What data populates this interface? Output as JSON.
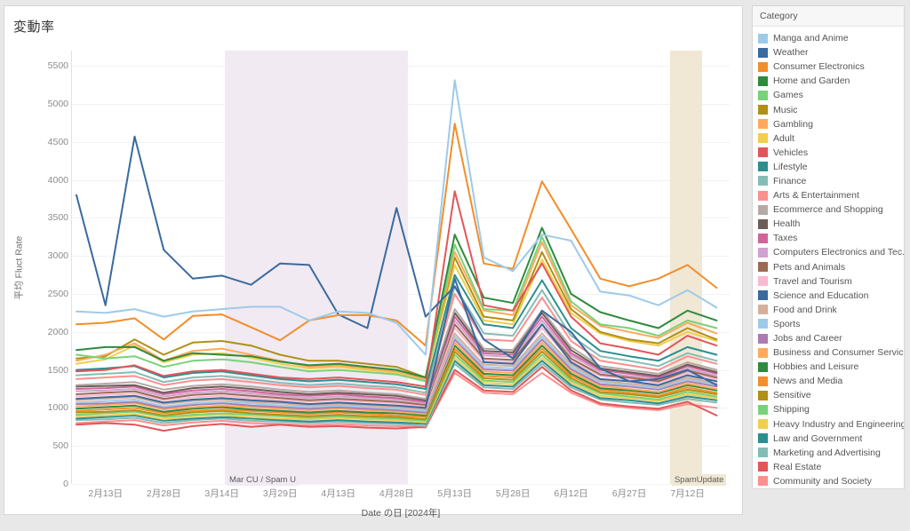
{
  "chart_title": "変動率",
  "axes": {
    "y_title": "平均 Fluct Rate",
    "y_ticks": [
      0,
      500,
      1000,
      1500,
      2000,
      2500,
      3000,
      3500,
      4000,
      4500,
      5000,
      5500
    ],
    "x_title": "Date の日 [2024年]",
    "x_ticks": [
      "2月13日",
      "2月28日",
      "3月14日",
      "3月29日",
      "4月13日",
      "4月28日",
      "5月13日",
      "5月28日",
      "6月12日",
      "6月27日",
      "7月12日"
    ]
  },
  "legend": {
    "header": "Category",
    "items": [
      {
        "label": "Manga and Anime",
        "color": "#9ecae9"
      },
      {
        "label": "Weather",
        "color": "#3a6a9e"
      },
      {
        "label": "Consumer Electronics",
        "color": "#f28e2b"
      },
      {
        "label": "Home and Garden",
        "color": "#2f8a3e"
      },
      {
        "label": "Games",
        "color": "#79d279"
      },
      {
        "label": "Music",
        "color": "#b09015"
      },
      {
        "label": "Gambling",
        "color": "#ffa95e"
      },
      {
        "label": "Adult",
        "color": "#f0ce4e"
      },
      {
        "label": "Vehicles",
        "color": "#e15759"
      },
      {
        "label": "Lifestyle",
        "color": "#2d8e8e"
      },
      {
        "label": "Finance",
        "color": "#86bcb6"
      },
      {
        "label": "Arts & Entertainment",
        "color": "#fd8f8f"
      },
      {
        "label": "Ecommerce and Shopping",
        "color": "#b5a9a5"
      },
      {
        "label": "Health",
        "color": "#6b5e57"
      },
      {
        "label": "Taxes",
        "color": "#d0659a"
      },
      {
        "label": "Computers Electronics and Tec..",
        "color": "#cfa2cf"
      },
      {
        "label": "Pets and Animals",
        "color": "#9c6b54"
      },
      {
        "label": "Travel and Tourism",
        "color": "#f9b9cf"
      },
      {
        "label": "Science and Education",
        "color": "#3a6a9e"
      },
      {
        "label": "Food and Drink",
        "color": "#d3b09c"
      },
      {
        "label": "Sports",
        "color": "#9ecae9"
      },
      {
        "label": "Jobs and Career",
        "color": "#ac7cb0"
      },
      {
        "label": "Business and Consumer Services",
        "color": "#ffa95e"
      },
      {
        "label": "Hobbies and Leisure",
        "color": "#2f8a3e"
      },
      {
        "label": "News and Media",
        "color": "#f28e2b"
      },
      {
        "label": "Sensitive",
        "color": "#b09015"
      },
      {
        "label": "Shipping",
        "color": "#79d279"
      },
      {
        "label": "Heavy Industry and Engineering",
        "color": "#f0ce4e"
      },
      {
        "label": "Law and Government",
        "color": "#2d8e8e"
      },
      {
        "label": "Marketing and Advertising",
        "color": "#86bcb6"
      },
      {
        "label": "Real Estate",
        "color": "#e15759"
      },
      {
        "label": "Community and Society",
        "color": "#fd8f8f"
      }
    ]
  },
  "annotations": [
    {
      "label": "Mar CU / Spam U",
      "color": "#f1eaf2",
      "x_start": 5.1,
      "x_end": 11.4
    },
    {
      "label": "SpamUpdate",
      "color": "#f0e8d5",
      "x_start": 20.4,
      "x_end": 21.5
    }
  ],
  "chart_data": {
    "type": "line",
    "title": "変動率",
    "xlabel": "Date の日 [2024年]",
    "ylabel": "平均 Fluct Rate",
    "ylim": [
      0,
      5700
    ],
    "grid": true,
    "legend_position": "right",
    "x": [
      "2月6日",
      "2月13日",
      "2月20日",
      "2月28日",
      "3月6日",
      "3月14日",
      "3月21日",
      "3月29日",
      "4月6日",
      "4月13日",
      "4月20日",
      "4月28日",
      "5月6日",
      "5月13日",
      "5月20日",
      "5月28日",
      "6月5日",
      "6月12日",
      "6月20日",
      "6月27日",
      "7月5日",
      "7月12日",
      "7月19日"
    ],
    "series": [
      {
        "name": "Weather",
        "color": "#3a6a9e",
        "values": [
          3800,
          2350,
          4570,
          3080,
          2700,
          2740,
          2620,
          2900,
          2880,
          2230,
          2050,
          3630,
          2200,
          2600,
          1900,
          1650,
          2280,
          2000,
          1520,
          1350,
          1380,
          1500,
          1300
        ]
      },
      {
        "name": "Manga and Anime",
        "color": "#9ecae9",
        "values": [
          2270,
          2250,
          2300,
          2200,
          2270,
          2300,
          2330,
          2330,
          2150,
          2270,
          2250,
          2120,
          1700,
          5310,
          2980,
          2800,
          3280,
          3200,
          2530,
          2480,
          2350,
          2550,
          2320
        ]
      },
      {
        "name": "Consumer Electronics",
        "color": "#f28e2b",
        "values": [
          2100,
          2120,
          2180,
          1900,
          2210,
          2230,
          2060,
          1890,
          2150,
          2220,
          2220,
          2150,
          1820,
          4740,
          2900,
          2830,
          3980,
          3350,
          2700,
          2600,
          2700,
          2880,
          2580
        ]
      },
      {
        "name": "Home and Garden",
        "color": "#2f8a3e",
        "values": [
          1760,
          1800,
          1800,
          1620,
          1720,
          1700,
          1680,
          1610,
          1560,
          1580,
          1540,
          1500,
          1400,
          3280,
          2450,
          2380,
          3370,
          2500,
          2260,
          2150,
          2050,
          2280,
          2150
        ]
      },
      {
        "name": "Games",
        "color": "#79d279",
        "values": [
          1700,
          1650,
          1680,
          1540,
          1620,
          1640,
          1600,
          1540,
          1480,
          1500,
          1470,
          1440,
          1350,
          3150,
          2300,
          2280,
          3250,
          2400,
          2100,
          2050,
          1950,
          2150,
          2050
        ]
      },
      {
        "name": "Music",
        "color": "#b09015",
        "values": [
          1650,
          1680,
          1900,
          1700,
          1860,
          1880,
          1820,
          1700,
          1620,
          1620,
          1580,
          1540,
          1400,
          2980,
          2200,
          2150,
          3050,
          2300,
          2000,
          1900,
          1850,
          2050,
          1900
        ]
      },
      {
        "name": "Gambling",
        "color": "#ffa95e",
        "values": [
          1620,
          1700,
          1850,
          1620,
          1750,
          1780,
          1700,
          1620,
          1540,
          1560,
          1520,
          1480,
          1380,
          3050,
          2280,
          2220,
          3180,
          2350,
          2080,
          2000,
          1920,
          2120,
          1980
        ]
      },
      {
        "name": "Adult",
        "color": "#f0ce4e",
        "values": [
          1580,
          1640,
          1820,
          1600,
          1700,
          1720,
          1660,
          1580,
          1520,
          1540,
          1500,
          1460,
          1360,
          2880,
          2150,
          2100,
          2950,
          2250,
          1980,
          1880,
          1820,
          2000,
          1880
        ]
      },
      {
        "name": "Vehicles",
        "color": "#e15759",
        "values": [
          1480,
          1500,
          1560,
          1420,
          1480,
          1500,
          1450,
          1400,
          1380,
          1400,
          1370,
          1340,
          1280,
          3850,
          2350,
          2280,
          2900,
          2200,
          1850,
          1780,
          1700,
          1950,
          1820
        ]
      },
      {
        "name": "Lifestyle",
        "color": "#2d8e8e",
        "values": [
          1500,
          1520,
          1550,
          1400,
          1460,
          1480,
          1430,
          1380,
          1350,
          1370,
          1340,
          1310,
          1250,
          2750,
          2100,
          2050,
          2680,
          2050,
          1750,
          1680,
          1620,
          1800,
          1700
        ]
      },
      {
        "name": "Finance",
        "color": "#86bcb6",
        "values": [
          1430,
          1450,
          1470,
          1340,
          1400,
          1420,
          1380,
          1330,
          1300,
          1320,
          1290,
          1270,
          1200,
          2600,
          1980,
          1950,
          2550,
          1950,
          1680,
          1620,
          1550,
          1720,
          1620
        ]
      },
      {
        "name": "Arts & Entertainment",
        "color": "#fd8f8f",
        "values": [
          1380,
          1400,
          1420,
          1300,
          1360,
          1380,
          1340,
          1300,
          1270,
          1290,
          1260,
          1240,
          1170,
          2500,
          1900,
          1880,
          2450,
          1880,
          1620,
          1560,
          1500,
          1680,
          1580
        ]
      },
      {
        "name": "Ecommerce and Shopping",
        "color": "#b5a9a5",
        "values": [
          1300,
          1320,
          1340,
          1240,
          1290,
          1310,
          1280,
          1240,
          1210,
          1230,
          1200,
          1180,
          1120,
          2300,
          1780,
          1760,
          2280,
          1800,
          1550,
          1500,
          1450,
          1600,
          1500
        ]
      },
      {
        "name": "Health",
        "color": "#6b5e57",
        "values": [
          1280,
          1290,
          1300,
          1200,
          1260,
          1280,
          1250,
          1210,
          1180,
          1200,
          1180,
          1160,
          1100,
          2250,
          1750,
          1730,
          2250,
          1760,
          1520,
          1470,
          1420,
          1570,
          1470
        ]
      },
      {
        "name": "Taxes",
        "color": "#d0659a",
        "values": [
          1250,
          1260,
          1280,
          1180,
          1230,
          1250,
          1220,
          1180,
          1160,
          1180,
          1150,
          1130,
          1080,
          2200,
          1720,
          1700,
          2200,
          1720,
          1500,
          1450,
          1400,
          1550,
          1450
        ]
      },
      {
        "name": "Computers Electronics and Tec..",
        "color": "#cfa2cf",
        "values": [
          1220,
          1230,
          1250,
          1150,
          1200,
          1220,
          1190,
          1160,
          1130,
          1150,
          1130,
          1110,
          1060,
          2150,
          1690,
          1670,
          2150,
          1690,
          1470,
          1420,
          1380,
          1520,
          1420
        ]
      },
      {
        "name": "Pets and Animals",
        "color": "#9c6b54",
        "values": [
          1180,
          1200,
          1220,
          1120,
          1170,
          1190,
          1160,
          1130,
          1100,
          1120,
          1100,
          1080,
          1040,
          2100,
          1650,
          1630,
          2100,
          1650,
          1440,
          1400,
          1350,
          1490,
          1400
        ]
      },
      {
        "name": "Travel and Tourism",
        "color": "#f9b9cf",
        "values": [
          1150,
          1170,
          1190,
          1100,
          1140,
          1160,
          1130,
          1100,
          1080,
          1100,
          1080,
          1060,
          1020,
          2050,
          1620,
          1600,
          2050,
          1620,
          1420,
          1380,
          1330,
          1460,
          1380
        ]
      },
      {
        "name": "Science and Education",
        "color": "#3a6a9e",
        "values": [
          1120,
          1140,
          1160,
          1070,
          1110,
          1130,
          1100,
          1080,
          1050,
          1070,
          1050,
          1030,
          1000,
          2700,
          1600,
          1580,
          2100,
          1600,
          1380,
          1350,
          1300,
          1430,
          1350
        ]
      },
      {
        "name": "Food and Drink",
        "color": "#d3b09c",
        "values": [
          1100,
          1120,
          1140,
          1050,
          1090,
          1110,
          1080,
          1060,
          1030,
          1050,
          1030,
          1010,
          980,
          1980,
          1570,
          1550,
          1980,
          1570,
          1360,
          1320,
          1280,
          1400,
          1320
        ]
      },
      {
        "name": "Sports",
        "color": "#9ecae9",
        "values": [
          1070,
          1090,
          1110,
          1020,
          1060,
          1080,
          1060,
          1030,
          1010,
          1030,
          1010,
          990,
          960,
          1940,
          1540,
          1520,
          1940,
          1540,
          1340,
          1300,
          1260,
          1380,
          1300
        ]
      },
      {
        "name": "Jobs and Career",
        "color": "#ac7cb0",
        "values": [
          1050,
          1060,
          1080,
          1000,
          1040,
          1060,
          1030,
          1010,
          990,
          1010,
          990,
          970,
          940,
          1900,
          1510,
          1490,
          1900,
          1510,
          1310,
          1280,
          1240,
          1350,
          1280
        ]
      },
      {
        "name": "Business and Consumer Services",
        "color": "#ffa95e",
        "values": [
          1020,
          1040,
          1060,
          980,
          1010,
          1030,
          1010,
          990,
          970,
          990,
          970,
          950,
          920,
          1860,
          1480,
          1460,
          1860,
          1480,
          1290,
          1250,
          1210,
          1320,
          1250
        ]
      },
      {
        "name": "Hobbies and Leisure",
        "color": "#2f8a3e",
        "values": [
          990,
          1010,
          1030,
          950,
          990,
          1010,
          980,
          960,
          940,
          960,
          940,
          930,
          900,
          1820,
          1450,
          1430,
          1820,
          1450,
          1260,
          1230,
          1190,
          1300,
          1230
        ]
      },
      {
        "name": "News and Media",
        "color": "#f28e2b",
        "values": [
          960,
          980,
          1000,
          930,
          960,
          980,
          960,
          940,
          920,
          940,
          920,
          900,
          880,
          1780,
          1420,
          1400,
          1780,
          1420,
          1240,
          1200,
          1160,
          1270,
          1200
        ]
      },
      {
        "name": "Sensitive",
        "color": "#b09015",
        "values": [
          940,
          950,
          970,
          900,
          940,
          960,
          930,
          910,
          890,
          910,
          890,
          880,
          850,
          1740,
          1390,
          1370,
          1740,
          1390,
          1210,
          1180,
          1140,
          1240,
          1180
        ]
      },
      {
        "name": "Shipping",
        "color": "#79d279",
        "values": [
          910,
          930,
          950,
          880,
          910,
          930,
          910,
          890,
          870,
          890,
          870,
          860,
          830,
          1700,
          1360,
          1340,
          1700,
          1360,
          1190,
          1150,
          1110,
          1210,
          1150
        ]
      },
      {
        "name": "Heavy Industry and Engineering",
        "color": "#f0ce4e",
        "values": [
          890,
          900,
          920,
          850,
          890,
          910,
          880,
          860,
          850,
          870,
          850,
          840,
          810,
          1660,
          1330,
          1310,
          1660,
          1330,
          1160,
          1130,
          1090,
          1180,
          1130
        ]
      },
      {
        "name": "Law and Government",
        "color": "#2d8e8e",
        "values": [
          860,
          880,
          900,
          830,
          860,
          880,
          860,
          840,
          820,
          840,
          820,
          810,
          790,
          1620,
          1300,
          1280,
          1620,
          1300,
          1130,
          1100,
          1060,
          1150,
          1100
        ]
      },
      {
        "name": "Marketing and Advertising",
        "color": "#86bcb6",
        "values": [
          840,
          850,
          870,
          800,
          840,
          860,
          830,
          820,
          800,
          820,
          800,
          790,
          760,
          1580,
          1270,
          1250,
          1580,
          1270,
          1110,
          1070,
          1040,
          1120,
          1070
        ]
      },
      {
        "name": "Real Estate",
        "color": "#e15759",
        "values": [
          780,
          800,
          780,
          700,
          760,
          790,
          750,
          780,
          750,
          760,
          740,
          730,
          750,
          1500,
          1230,
          1210,
          1540,
          1230,
          1060,
          1020,
          990,
          1080,
          900
        ]
      },
      {
        "name": "Community and Society",
        "color": "#fd8f8f",
        "values": [
          800,
          820,
          840,
          770,
          810,
          830,
          800,
          790,
          770,
          790,
          770,
          760,
          740,
          1460,
          1200,
          1180,
          1460,
          1200,
          1040,
          1000,
          970,
          1050,
          1000
        ]
      }
    ]
  }
}
